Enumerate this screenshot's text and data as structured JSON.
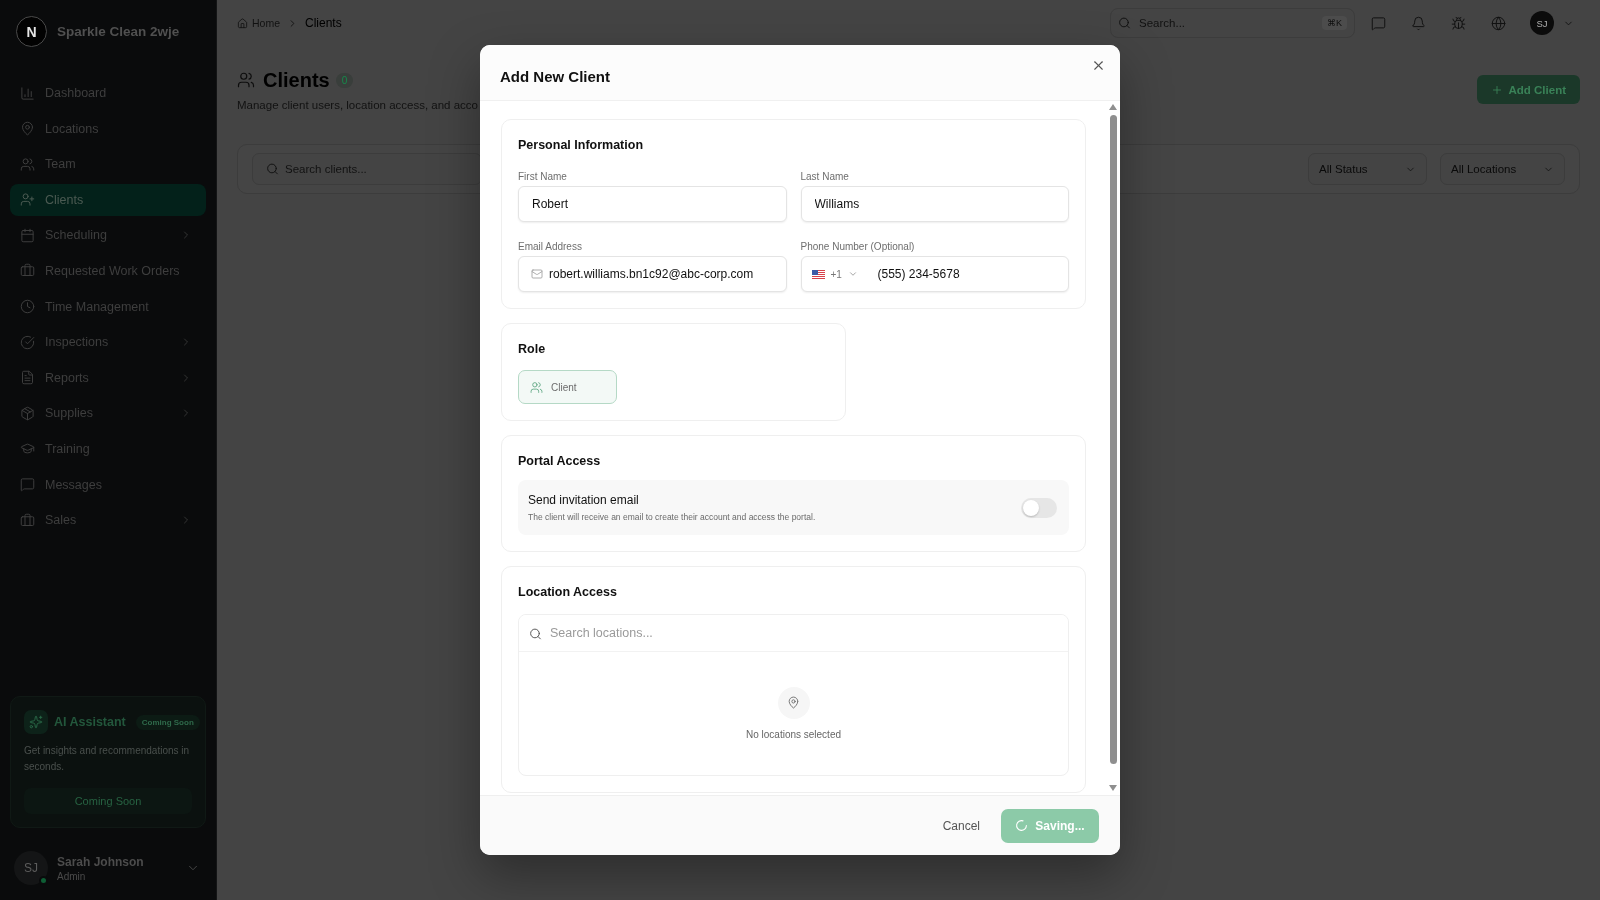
{
  "sidebar": {
    "logo_letter": "N",
    "brand": "Sparkle Clean 2wje",
    "items": [
      {
        "label": "Dashboard",
        "selected": false,
        "expandable": false
      },
      {
        "label": "Locations",
        "selected": false,
        "expandable": false
      },
      {
        "label": "Team",
        "selected": false,
        "expandable": false
      },
      {
        "label": "Clients",
        "selected": true,
        "expandable": false
      },
      {
        "label": "Scheduling",
        "selected": false,
        "expandable": true
      },
      {
        "label": "Requested Work Orders",
        "selected": false,
        "expandable": false
      },
      {
        "label": "Time Management",
        "selected": false,
        "expandable": false
      },
      {
        "label": "Inspections",
        "selected": false,
        "expandable": true
      },
      {
        "label": "Reports",
        "selected": false,
        "expandable": true
      },
      {
        "label": "Supplies",
        "selected": false,
        "expandable": true
      },
      {
        "label": "Training",
        "selected": false,
        "expandable": false
      },
      {
        "label": "Messages",
        "selected": false,
        "expandable": false
      },
      {
        "label": "Sales",
        "selected": false,
        "expandable": true
      }
    ],
    "ai_assistant": {
      "title": "AI Assistant",
      "badge": "Coming Soon",
      "description": "Get insights and recommendations in seconds.",
      "button": "Coming Soon"
    },
    "user": {
      "initials": "SJ",
      "name": "Sarah Johnson",
      "role": "Admin",
      "online": true
    }
  },
  "top_bar": {
    "breadcrumb": [
      {
        "label": "Home",
        "current": false
      },
      {
        "label": "Clients",
        "current": true
      }
    ],
    "search": {
      "placeholder": "Search...",
      "shortcut": "⌘K"
    },
    "avatar": "SJ"
  },
  "page": {
    "title": "Clients",
    "count": "0",
    "subtitle": "Manage client users, location access, and acco",
    "add_button": "Add Client",
    "search_placeholder": "Search clients...",
    "filters": [
      "All Status",
      "All Locations"
    ]
  },
  "dialog": {
    "title": "Add New Client",
    "personal": {
      "title": "Personal Information",
      "fields": [
        {
          "kind": "text",
          "label": "First Name",
          "value": "Robert"
        },
        {
          "kind": "text",
          "label": "Last Name",
          "value": "Williams"
        },
        {
          "kind": "email",
          "label": "Email Address",
          "value": "robert.williams.bn1c92@abc-corp.com"
        },
        {
          "kind": "phone",
          "label": "Phone Number (Optional)",
          "country_code": "+1",
          "value": "(555) 234-5678"
        }
      ]
    },
    "role": {
      "title": "Role",
      "options": [
        {
          "label": "Client",
          "selected": true
        }
      ]
    },
    "portal": {
      "title": "Portal Access",
      "setting": {
        "label": "Send invitation email",
        "description": "The client will receive an email to create their account and access the portal.",
        "on": false
      }
    },
    "locations": {
      "title": "Location Access",
      "search_placeholder": "Search locations...",
      "empty_text": "No locations selected"
    },
    "footer": {
      "cancel": "Cancel",
      "submit": "Saving...",
      "busy": true
    }
  }
}
